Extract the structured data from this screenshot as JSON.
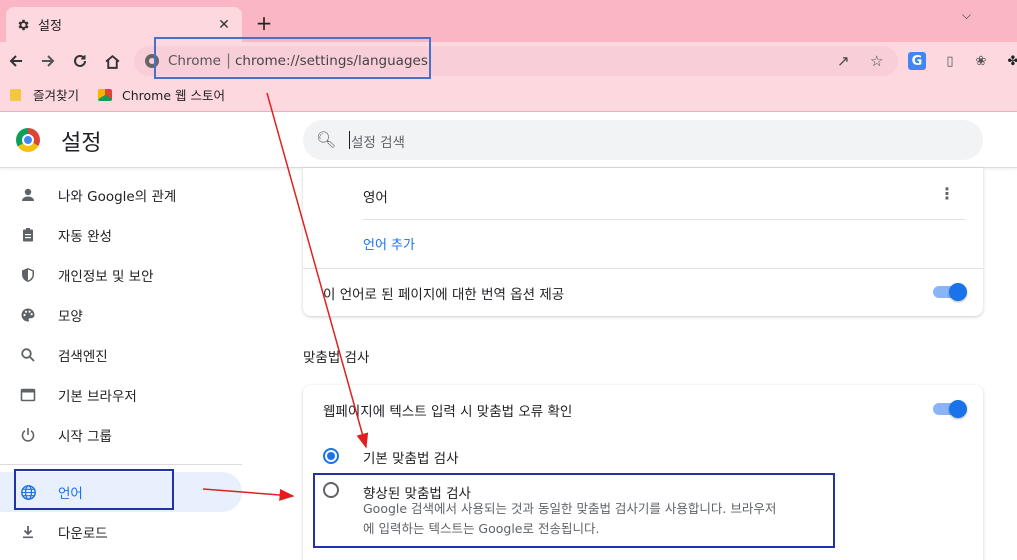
{
  "browser": {
    "tab_title": "설정",
    "tab_close": "✕",
    "new_tab": "+",
    "omnibox_scheme_label": "Chrome",
    "omnibox_separator": "|",
    "omnibox_url": "chrome://settings/languages",
    "bookmarks": [
      {
        "label": "즐겨찾기",
        "icon": "folder-icon"
      },
      {
        "label": "Chrome 웹 스토어",
        "icon": "webstore-icon"
      }
    ]
  },
  "settings": {
    "title": "설정",
    "search_placeholder": "설정 검색"
  },
  "sidebar": {
    "items": [
      {
        "label": "나와 Google의 관계",
        "icon": "person-icon"
      },
      {
        "label": "자동 완성",
        "icon": "clipboard-icon"
      },
      {
        "label": "개인정보 및 보안",
        "icon": "shield-icon"
      },
      {
        "label": "모양",
        "icon": "palette-icon"
      },
      {
        "label": "검색엔진",
        "icon": "search-icon"
      },
      {
        "label": "기본 브라우저",
        "icon": "browser-icon"
      },
      {
        "label": "시작 그룹",
        "icon": "power-icon"
      },
      {
        "label": "언어",
        "icon": "globe-icon",
        "active": true
      },
      {
        "label": "다운로드",
        "icon": "download-icon"
      }
    ]
  },
  "languages_card": {
    "language": "영어",
    "add_language": "언어 추가",
    "offer_translate": "이 언어로 된 페이지에 대한 번역 옵션 제공",
    "offer_translate_on": true
  },
  "spell_check": {
    "section_title": "맞춤법 검사",
    "check_label": "웹페이지에 텍스트 입력 시 맞춤법 오류 확인",
    "check_on": true,
    "basic_label": "기본 맞춤법 검사",
    "basic_selected": true,
    "enhanced_label": "향상된 맞춤법 검사",
    "enhanced_desc_line1": "Google 검색에서 사용되는 것과 동일한 맞춤법 검사기를 사용합니다. 브라우저",
    "enhanced_desc_line2": "에 입력하는 텍스트는 Google로 전송됩니다.",
    "enhanced_selected": false
  },
  "colors": {
    "accent": "#1a73e8",
    "annotation_arrow": "#e02020",
    "annotation_box": "#2233aa"
  }
}
